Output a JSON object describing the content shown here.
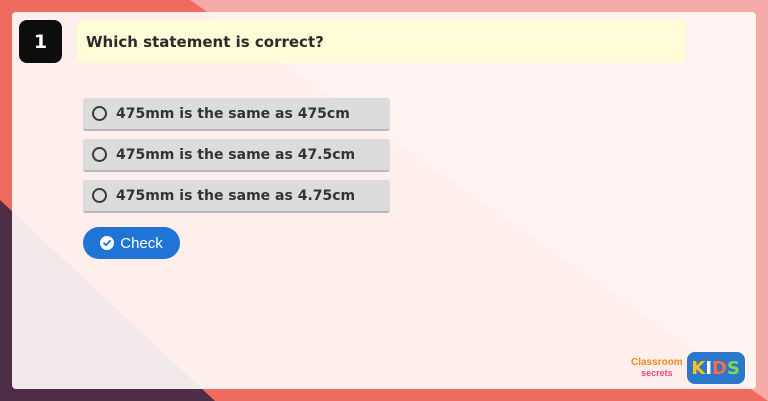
{
  "question": {
    "number": "1",
    "text": "Which statement is correct?"
  },
  "options": [
    {
      "label": "475mm is the same as 475cm",
      "selected": false
    },
    {
      "label": "475mm is the same as 47.5cm",
      "selected": false
    },
    {
      "label": "475mm is the same as 4.75cm",
      "selected": false
    }
  ],
  "check_button": {
    "label": "Check",
    "icon": "check-circle-icon"
  },
  "branding": {
    "classroom": "Classroom",
    "secrets": "secrets",
    "kids_letters": [
      "K",
      "I",
      "D",
      "S"
    ],
    "kids_colors": [
      "#f5c518",
      "#ffffff",
      "#ff6b4a",
      "#7ed957"
    ]
  },
  "colors": {
    "question_bg": "#fefdd7",
    "number_bg": "#0d0d0d",
    "option_bg": "#dcdcdc",
    "button_bg": "#1f74d6"
  }
}
